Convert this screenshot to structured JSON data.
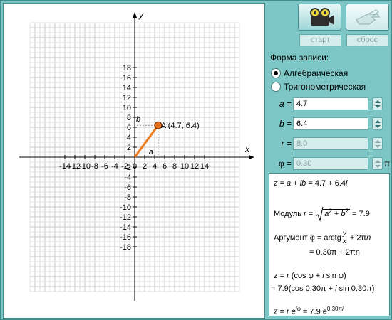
{
  "plot": {
    "x_label": "x",
    "y_label": "y",
    "x_ticks": [
      "-14",
      "-12",
      "-10",
      "-8",
      "-6",
      "-4",
      "-2",
      "0",
      "2",
      "4",
      "6",
      "8",
      "10",
      "12",
      "14"
    ],
    "y_ticks": [
      "18",
      "16",
      "14",
      "12",
      "10",
      "8",
      "6",
      "4",
      "2",
      "-2",
      "-4",
      "-6",
      "-8",
      "-10",
      "-12",
      "-14",
      "-16",
      "-18"
    ],
    "point_label": "A (4.7; 6.4)",
    "proj_a_label": "a",
    "proj_b_label": "b",
    "point": {
      "x": 4.7,
      "y": 6.4
    },
    "vector_color": "#f07a1a"
  },
  "controls": {
    "start_label": "старт",
    "reset_label": "сброс",
    "start_icon": "film-camera-icon",
    "reset_icon": "hand-icon"
  },
  "form": {
    "title": "Форма записи:",
    "options": [
      "Алгебраическая",
      "Тригонометрическая"
    ],
    "selected": "Алгебраическая"
  },
  "fields": {
    "a_label": "a =",
    "a_value": "4.7",
    "b_label": "b =",
    "b_value": "6.4",
    "r_label": "r =",
    "r_value": "8.0",
    "phi_label": "φ =",
    "phi_value": "0.30",
    "phi_unit": "π"
  },
  "formula": {
    "l1_value": "= 4.7 + 6.4",
    "modulus_word": "Модуль",
    "modulus_result": "= 7.9",
    "argument_word": "Аргумент",
    "argument_line2": "= 0.30π + 2πn",
    "trig_line2": "= 7.9(cos 0.30π + ",
    "trig_line2_tail": "sin 0.30π)",
    "exp_result": "= 7.9 e",
    "exp_power": "0.30π"
  },
  "colors": {
    "accent": "#7ec6c6",
    "panel_border": "#3f8f8f"
  }
}
